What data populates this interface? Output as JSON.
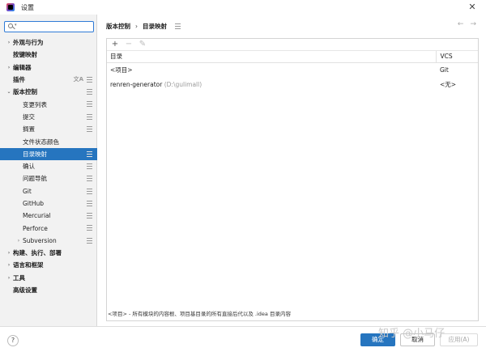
{
  "window": {
    "title": "设置",
    "close_glyph": "✕",
    "app_icon": "intellij-app-icon"
  },
  "sidebar": {
    "search": {
      "value": "",
      "placeholder": ""
    },
    "items": [
      {
        "label": "外观与行为",
        "expandable": true,
        "bold": true
      },
      {
        "label": "按键映射",
        "expandable": false,
        "bold": true
      },
      {
        "label": "编辑器",
        "expandable": true,
        "bold": true
      },
      {
        "label": "插件",
        "expandable": false,
        "bold": true,
        "extra_icon": "translate-icon"
      },
      {
        "label": "版本控制",
        "expandable": true,
        "expanded": true,
        "bold": true
      },
      {
        "label": "变更列表",
        "indent": 1
      },
      {
        "label": "提交",
        "indent": 1
      },
      {
        "label": "搁置",
        "indent": 1
      },
      {
        "label": "文件状态颜色",
        "indent": 1
      },
      {
        "label": "目录映射",
        "indent": 1,
        "selected": true
      },
      {
        "label": "确认",
        "indent": 1
      },
      {
        "label": "问题导航",
        "indent": 1
      },
      {
        "label": "Git",
        "indent": 1
      },
      {
        "label": "GitHub",
        "indent": 1
      },
      {
        "label": "Mercurial",
        "indent": 1
      },
      {
        "label": "Perforce",
        "indent": 1
      },
      {
        "label": "Subversion",
        "indent": 1,
        "expandable": true
      },
      {
        "label": "构建、执行、部署",
        "expandable": true,
        "bold": true
      },
      {
        "label": "语言和框架",
        "expandable": true,
        "bold": true
      },
      {
        "label": "工具",
        "expandable": true,
        "bold": true
      },
      {
        "label": "高级设置",
        "expandable": false,
        "bold": true
      }
    ]
  },
  "main": {
    "breadcrumb": {
      "parent": "版本控制",
      "separator": "›",
      "current": "目录映射"
    },
    "nav": {
      "back": "←",
      "forward": "→"
    },
    "toolbar": {
      "add": "+",
      "remove": "−",
      "edit": "✎"
    },
    "table": {
      "columns": [
        "目录",
        "VCS"
      ],
      "rows": [
        {
          "directory": "<项目>",
          "hint": "",
          "vcs": "Git"
        },
        {
          "directory": "renren-generator",
          "hint": "(D:\\gulimall)",
          "vcs": "<无>"
        }
      ]
    },
    "footnote": "<项目> - 所有模块的内容根、项目基目录的所有直接后代以及 .idea 目录内容"
  },
  "footer": {
    "help": "?",
    "ok": "确定",
    "cancel": "取消",
    "apply": "应用(A)"
  },
  "watermark": "知乎 @小马仔",
  "colors": {
    "accent": "#2675bf",
    "sidebar_bg": "#f2f2f2"
  }
}
